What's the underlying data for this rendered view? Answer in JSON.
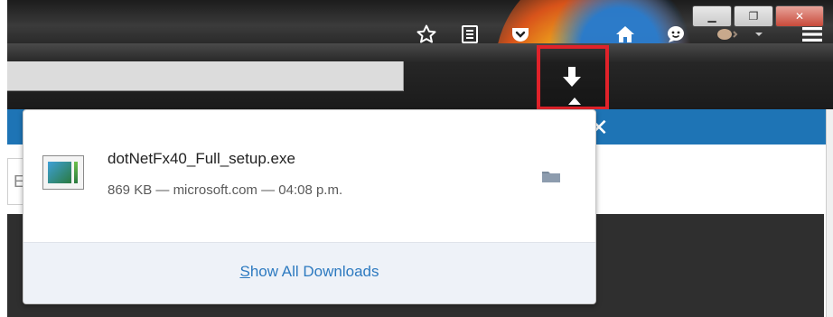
{
  "window": {
    "minimize_label": "▁",
    "maximize_label": "❐",
    "close_label": "✕"
  },
  "toolbar": {
    "icons": [
      "bookmark-star-icon",
      "reading-list-icon",
      "pocket-icon",
      "downloads-icon",
      "home-icon",
      "hello-chat-icon",
      "extension-icon",
      "menu-icon"
    ],
    "accent_highlight_color": "#e0222a"
  },
  "downloads_panel": {
    "item": {
      "file_name": "dotNetFx40_Full_setup.exe",
      "size": "869 KB",
      "separator": "—",
      "source": "microsoft.com",
      "time": "04:08 p.m."
    },
    "show_all": {
      "access_key": "S",
      "rest_label": "how All Downloads"
    },
    "link_color": "#2d7ac0"
  },
  "page": {
    "header_color": "#1e74b5",
    "close_glyph": "✕",
    "partial_box_letter": "E"
  }
}
